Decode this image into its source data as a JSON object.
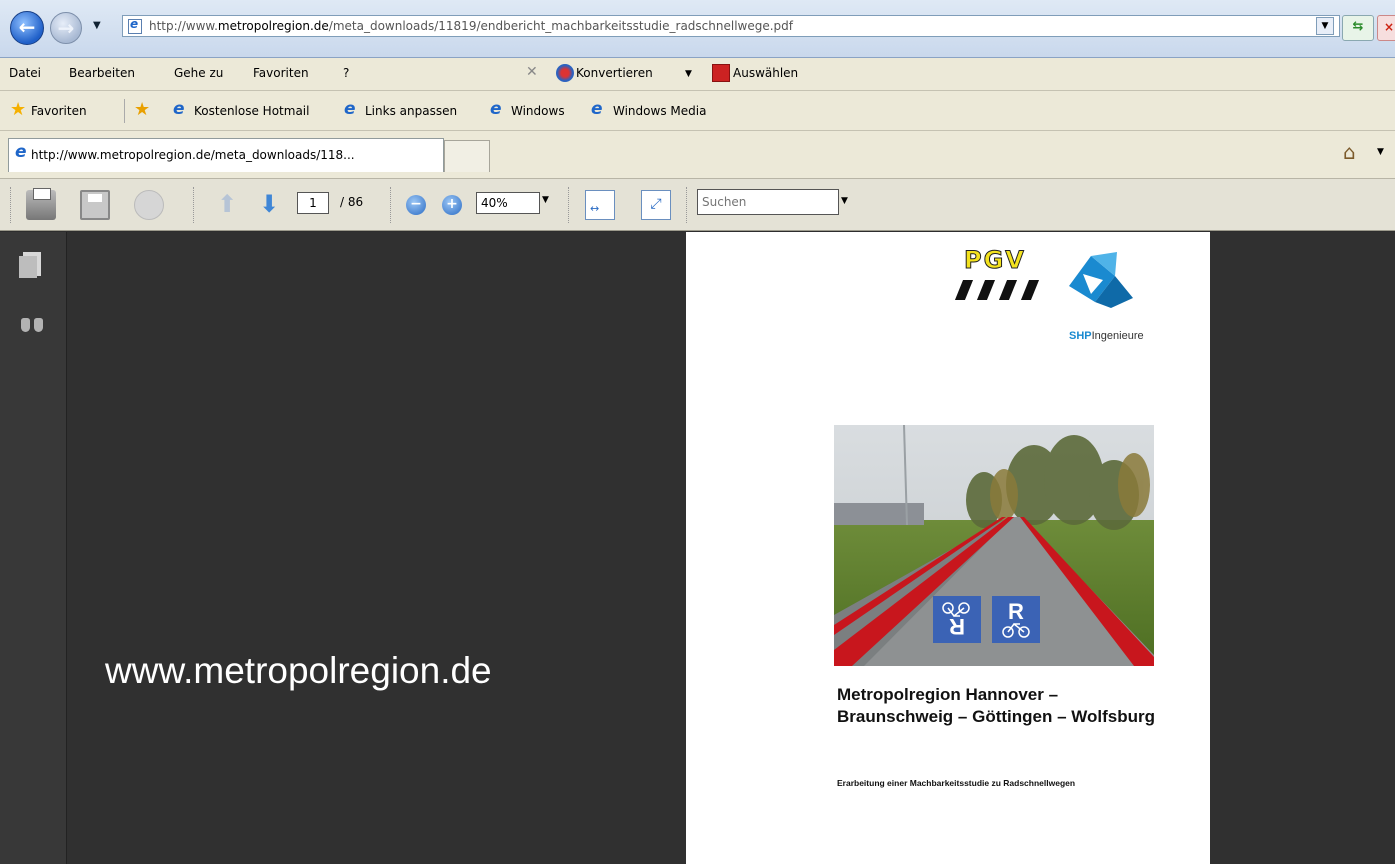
{
  "browser": {
    "address": {
      "url_host": "http://www.",
      "url_bold": "metropolregion.de",
      "url_path": "/meta_downloads/11819/endbericht_machbarkeitsstudie_radschnellwege.pdf"
    },
    "menu": {
      "items": [
        "Datei",
        "Bearbeiten",
        "Gehe zu",
        "Favoriten",
        "?"
      ],
      "convert_label": "Konvertieren",
      "convert_drop": "▼",
      "select_label": "Auswählen"
    },
    "favorites": {
      "label": "Favoriten",
      "links": [
        "Kostenlose Hotmail",
        "Links anpassen",
        "Windows",
        "Windows Media"
      ]
    },
    "tab": {
      "title": "http://www.metropolregion.de/meta_downloads/118..."
    }
  },
  "pdf_toolbar": {
    "page_current": "1",
    "page_total": "/ 86",
    "zoom": "40%",
    "search_placeholder": "Suchen",
    "zoom_out": "−",
    "zoom_in": "+"
  },
  "overlay_text": "www.metropolregion.de",
  "document": {
    "logo_pgv": "PGV",
    "logo_shp_bold": "SHP",
    "logo_shp_rest": "Ingenieure",
    "title": "Metropolregion Hannover – Braunschweig – Göttingen – Wolfsburg",
    "subtitle": "Erarbeitung einer Machbarkeitsstudie zu Radschnellwegen",
    "road_marking": "R"
  },
  "colors": {
    "viewer_bg": "#303030",
    "pgv_yellow": "#f3e21e",
    "shp_blue": "#1a8ad0",
    "lane_red": "#c8161d",
    "sign_blue": "#3b63b5"
  }
}
